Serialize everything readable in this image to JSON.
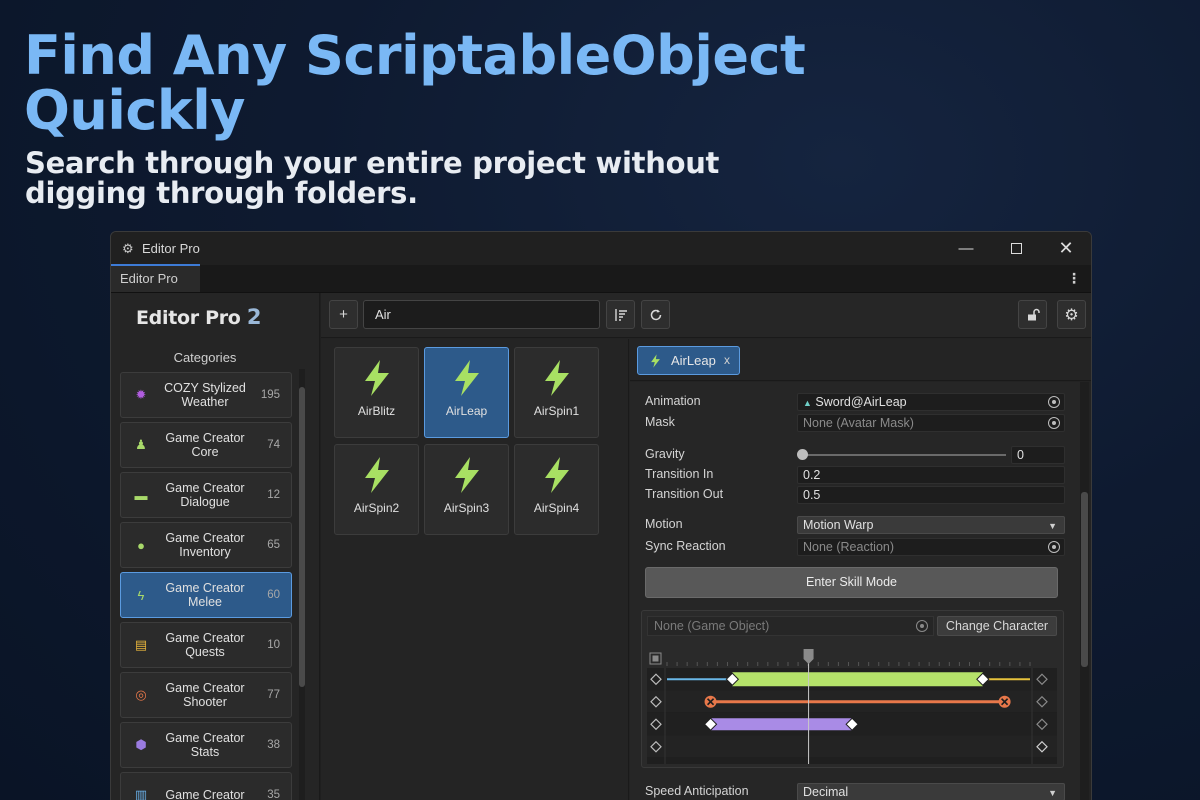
{
  "hero": {
    "title": "Find Any ScriptableObject Quickly",
    "subtitle": "Search through your entire project without digging through folders."
  },
  "window": {
    "title": "Editor Pro",
    "tab": "Editor Pro",
    "icons": {
      "app": "unity-gear-icon",
      "minimize": "minimize-icon",
      "maximize": "maximize-icon",
      "close": "close-icon",
      "menu": "kebab-menu-icon"
    }
  },
  "sidebar": {
    "logo_text": "Editor Pro",
    "logo_version": "2",
    "heading": "Categories",
    "items": [
      {
        "label": "COZY Stylized Weather",
        "count": "195",
        "icon": "sun-icon",
        "color": "#b15de0"
      },
      {
        "label": "Game Creator Core",
        "count": "74",
        "icon": "character-icon",
        "color": "#a8d96a"
      },
      {
        "label": "Game Creator Dialogue",
        "count": "12",
        "icon": "speech-bubble-icon",
        "color": "#a8d96a"
      },
      {
        "label": "Game Creator Inventory",
        "count": "65",
        "icon": "potion-icon",
        "color": "#a8d96a"
      },
      {
        "label": "Game Creator Melee",
        "count": "60",
        "icon": "bolt-icon",
        "color": "#a8d96a",
        "active": true
      },
      {
        "label": "Game Creator Quests",
        "count": "10",
        "icon": "scroll-icon",
        "color": "#e6b43c"
      },
      {
        "label": "Game Creator Shooter",
        "count": "77",
        "icon": "crosshair-icon",
        "color": "#e8784a"
      },
      {
        "label": "Game Creator Stats",
        "count": "38",
        "icon": "d20-icon",
        "color": "#9a7be0"
      },
      {
        "label": "Game Creator",
        "count": "35",
        "icon": "bars-icon",
        "color": "#6ab0e8"
      }
    ]
  },
  "toolbar": {
    "add_label": "+",
    "search_value": "Air",
    "icons": {
      "sort": "sort-icon",
      "refresh": "refresh-icon",
      "lock": "unlock-icon",
      "settings": "gear-icon"
    }
  },
  "results": [
    {
      "name": "AirBlitz"
    },
    {
      "name": "AirLeap",
      "active": true
    },
    {
      "name": "AirSpin1"
    },
    {
      "name": "AirSpin2"
    },
    {
      "name": "AirSpin3"
    },
    {
      "name": "AirSpin4"
    }
  ],
  "inspector": {
    "tab_label": "AirLeap",
    "tab_close": "x",
    "animation_label": "Animation",
    "animation_value": "Sword@AirLeap",
    "mask_label": "Mask",
    "mask_value": "None (Avatar Mask)",
    "gravity_label": "Gravity",
    "gravity_value": "0",
    "transition_in_label": "Transition In",
    "transition_in_value": "0.2",
    "transition_out_label": "Transition Out",
    "transition_out_value": "0.5",
    "motion_label": "Motion",
    "motion_value": "Motion Warp",
    "sync_label": "Sync Reaction",
    "sync_value": "None (Reaction)",
    "skill_button": "Enter Skill Mode",
    "game_object_value": "None (Game Object)",
    "change_character": "Change Character",
    "speed_label": "Speed Anticipation",
    "speed_value": "Decimal"
  },
  "timeline": {
    "tracks": [
      {
        "color": "#b5e26a",
        "start": 0.18,
        "end": 0.87,
        "line_color": "#6ab8e8",
        "end_line": "#e6c23c"
      },
      {
        "color": "#e8784a",
        "start": 0.12,
        "end": 0.93,
        "markers": "x"
      },
      {
        "color": "#a98be6",
        "start": 0.12,
        "end": 0.51
      }
    ],
    "playhead": 0.39
  },
  "colors": {
    "accent": "#2d5a8a",
    "accent_border": "#5b9be0",
    "hero_title": "#7ab8f5",
    "bolt": "#a8e063"
  }
}
